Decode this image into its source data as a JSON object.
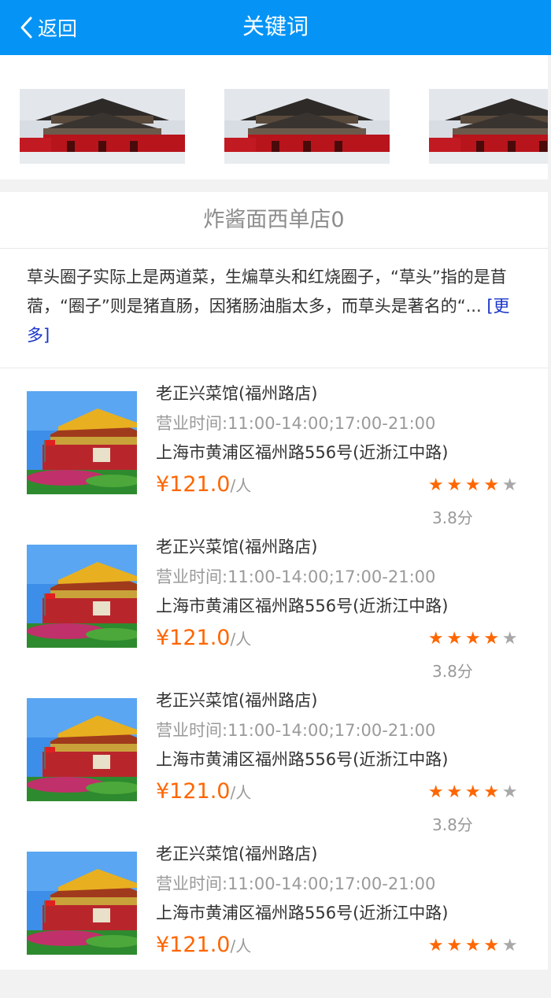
{
  "header": {
    "back_label": "返回",
    "title": "关键词"
  },
  "banner": {
    "images": [
      "gate-photo",
      "gate-photo",
      "gate-photo"
    ]
  },
  "store": {
    "title": "炸酱面西单店0",
    "description": "草头圈子实际上是两道菜，生煸草头和红烧圈子，“草头”指的是苜蓿，“圈子”则是猪直肠，因猪肠油脂太多，而草头是著名的“...",
    "more_label": "[更多]"
  },
  "restaurants": [
    {
      "name": "老正兴菜馆(福州路店)",
      "hours": "营业时间:11:00-14:00;17:00-21:00",
      "address": "上海市黄浦区福州路556号(近浙江中路)",
      "price": "¥121.0",
      "price_unit": "/人",
      "rating_stars": 4,
      "score": "3.8分"
    },
    {
      "name": "老正兴菜馆(福州路店)",
      "hours": "营业时间:11:00-14:00;17:00-21:00",
      "address": "上海市黄浦区福州路556号(近浙江中路)",
      "price": "¥121.0",
      "price_unit": "/人",
      "rating_stars": 4,
      "score": "3.8分"
    },
    {
      "name": "老正兴菜馆(福州路店)",
      "hours": "营业时间:11:00-14:00;17:00-21:00",
      "address": "上海市黄浦区福州路556号(近浙江中路)",
      "price": "¥121.0",
      "price_unit": "/人",
      "rating_stars": 4,
      "score": "3.8分"
    },
    {
      "name": "老正兴菜馆(福州路店)",
      "hours": "营业时间:11:00-14:00;17:00-21:00",
      "address": "上海市黄浦区福州路556号(近浙江中路)",
      "price": "¥121.0",
      "price_unit": "/人",
      "rating_stars": 4
    }
  ],
  "colors": {
    "header_bg": "#0594f5",
    "price": "#ff6600",
    "star_on": "#ff6600",
    "link": "#1a33c9"
  }
}
